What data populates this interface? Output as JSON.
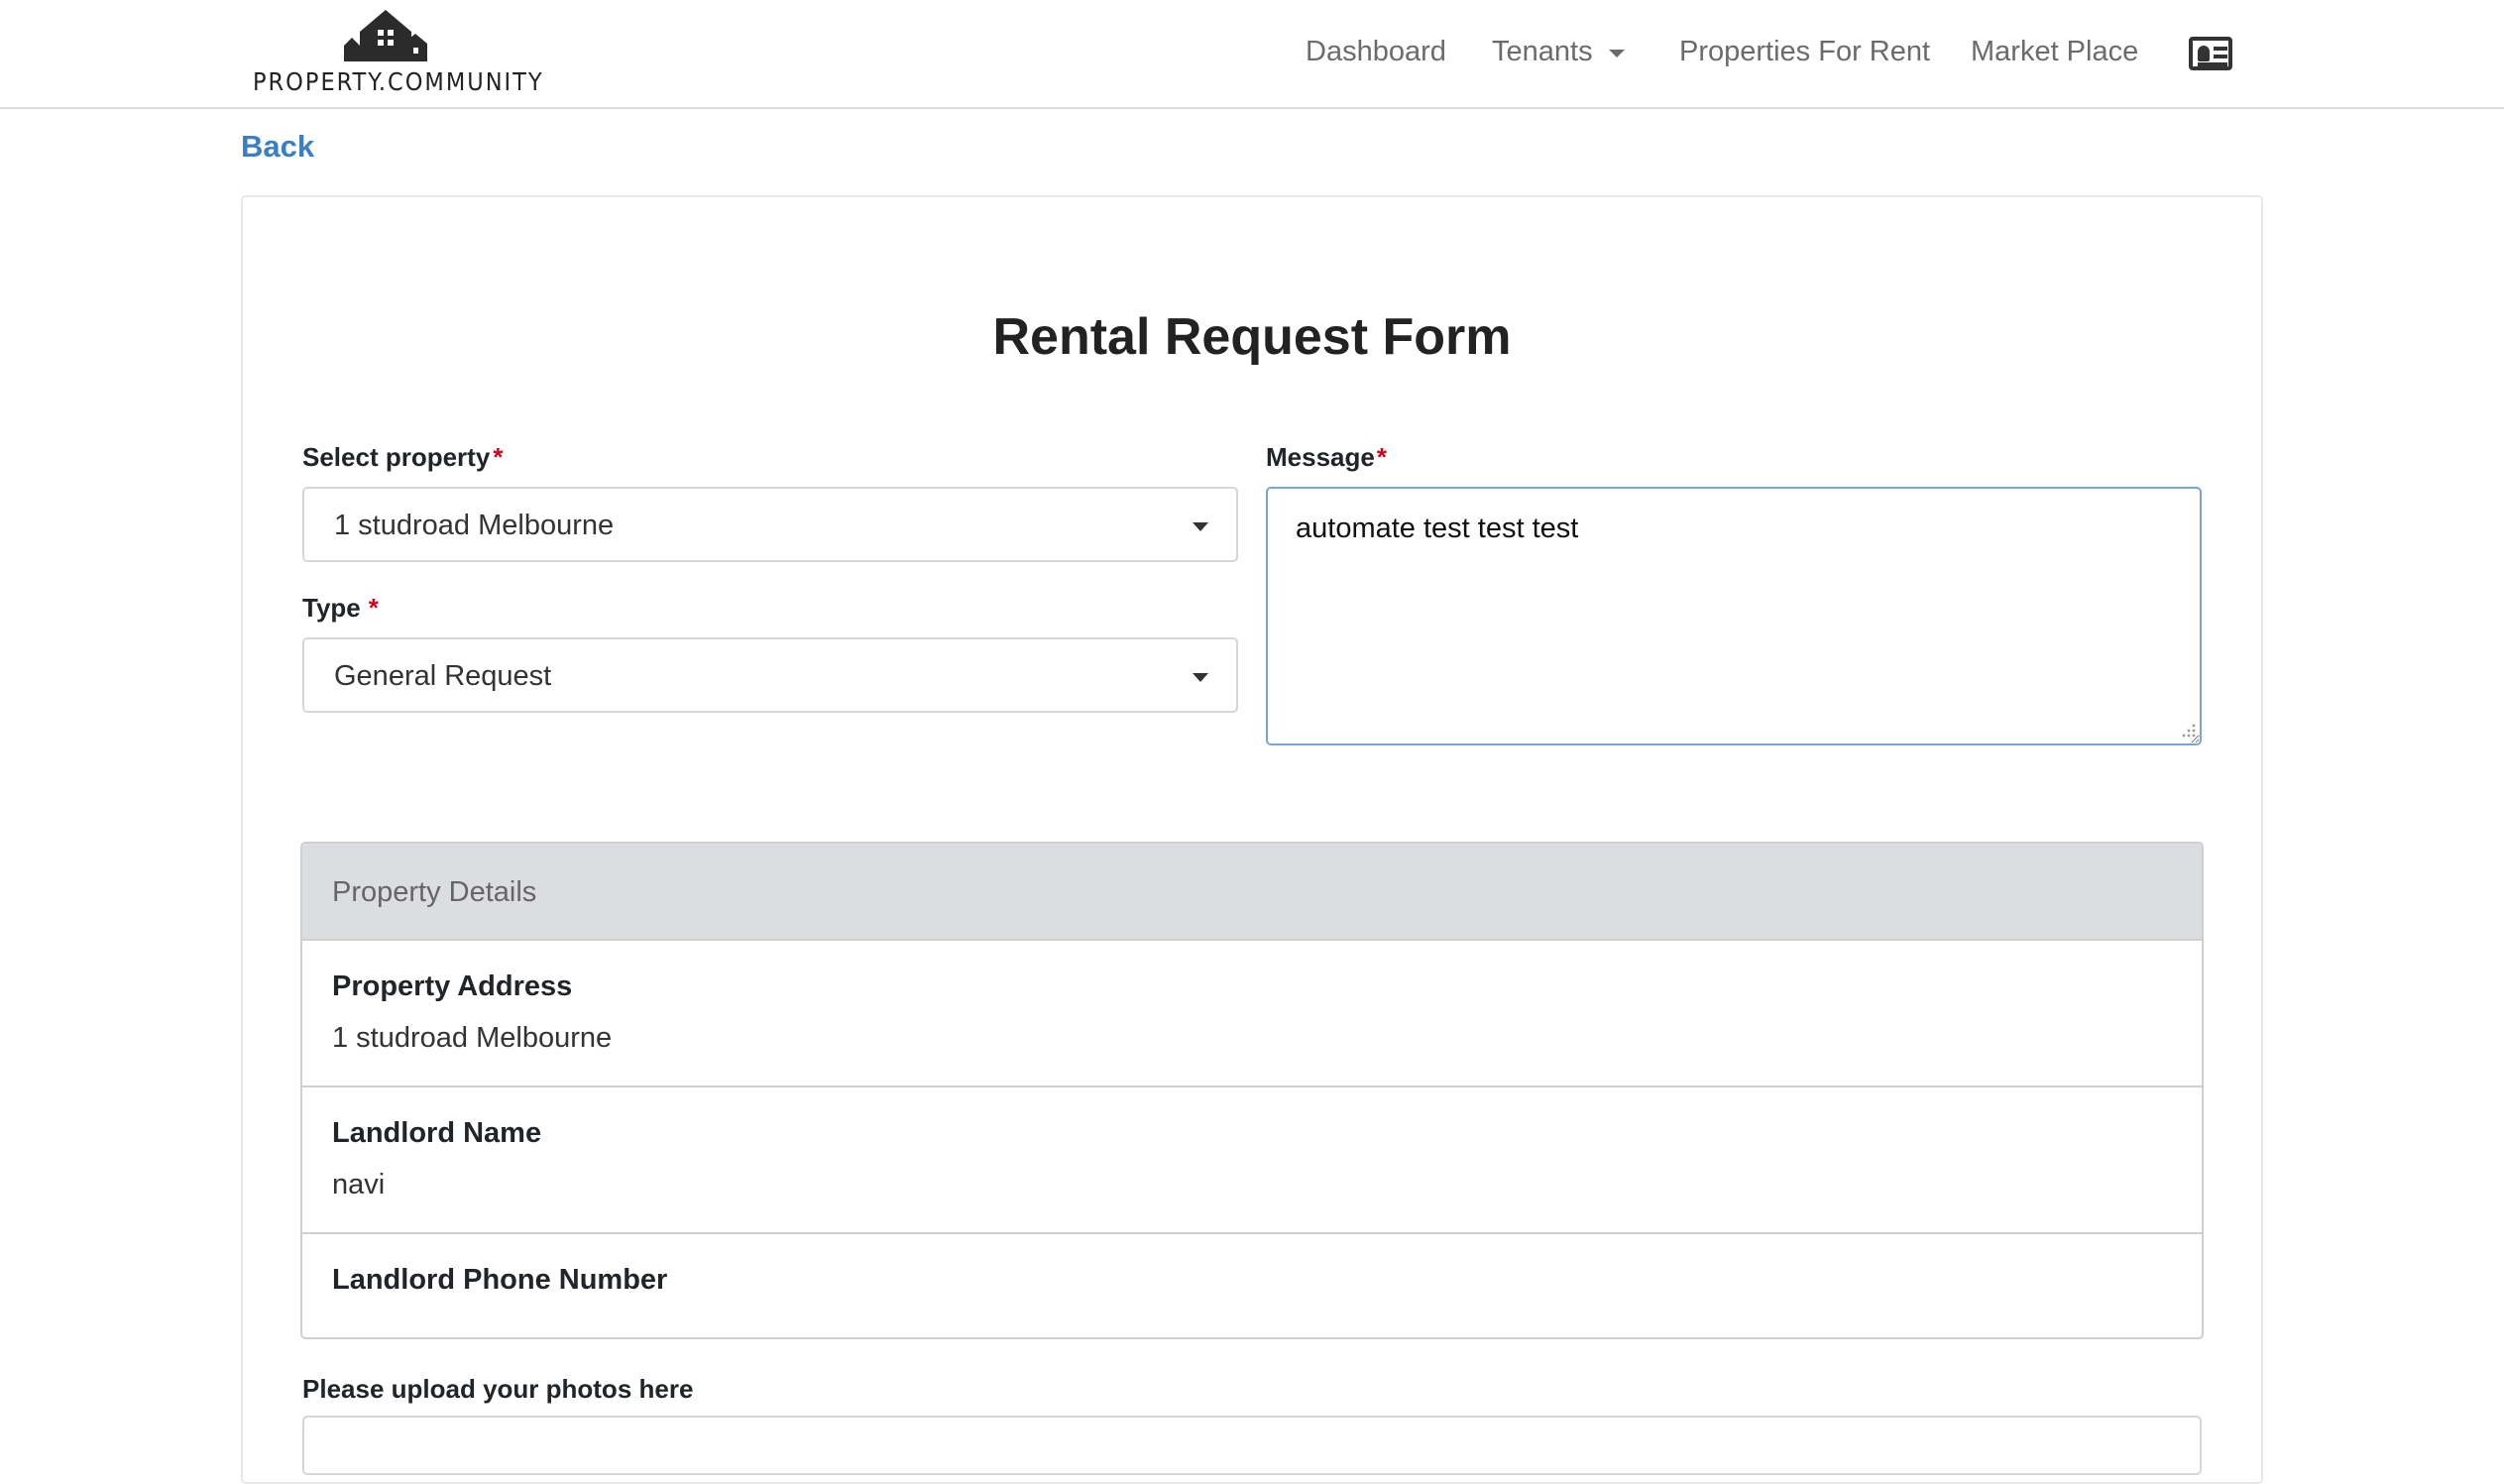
{
  "header": {
    "logo_text": "PROPERTY.COMMUNITY",
    "nav": {
      "dashboard": "Dashboard",
      "tenants": "Tenants",
      "properties_for_rent": "Properties For Rent",
      "market_place": "Market Place"
    },
    "profile_icon": "id-card-icon"
  },
  "back_label": "Back",
  "form": {
    "title": "Rental Request Form",
    "select_property_label": "Select property",
    "select_property_value": "1 studroad Melbourne",
    "type_label": "Type",
    "type_value": "General Request",
    "message_label": "Message",
    "message_value": "automate test test test",
    "required_mark": "*"
  },
  "property_details": {
    "heading": "Property Details",
    "address_label": "Property Address",
    "address_value": "1 studroad Melbourne",
    "landlord_name_label": "Landlord Name",
    "landlord_name_value": "navi",
    "landlord_phone_label": "Landlord Phone Number",
    "landlord_phone_value": ""
  },
  "upload": {
    "label": "Please upload your photos here"
  },
  "colors": {
    "link": "#3a7fc1",
    "required": "#d0021b",
    "focus_border": "#7aa7d2",
    "details_header_bg": "#dcdde0"
  }
}
